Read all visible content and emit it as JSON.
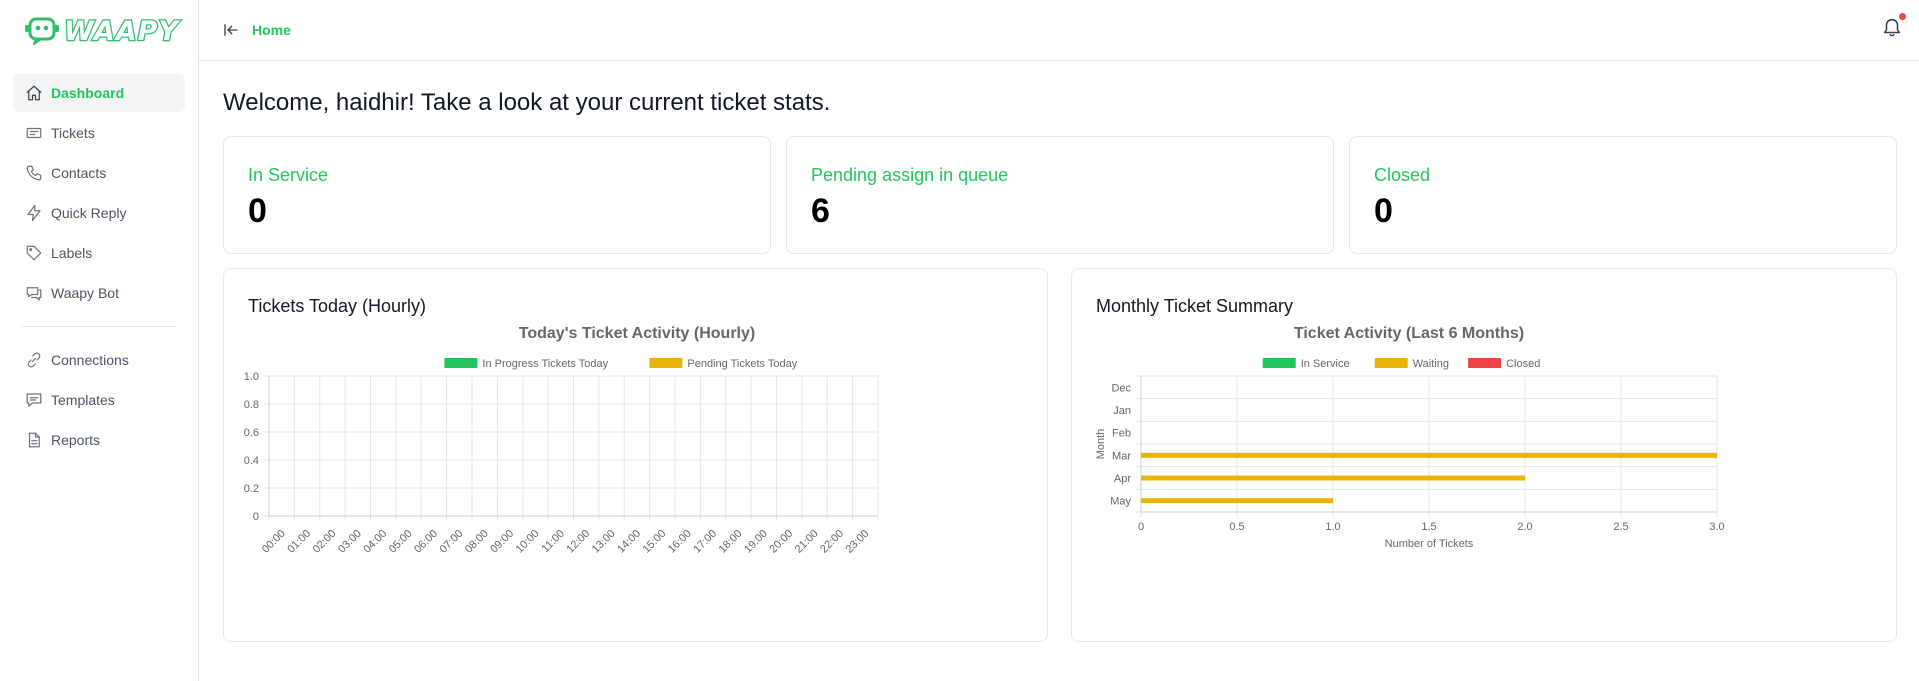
{
  "app": {
    "logo_text": "WAAPY"
  },
  "sidebar": {
    "items": [
      {
        "label": "Dashboard",
        "icon": "home-icon",
        "active": true
      },
      {
        "label": "Tickets",
        "icon": "ticket-icon"
      },
      {
        "label": "Contacts",
        "icon": "phone-icon"
      },
      {
        "label": "Quick Reply",
        "icon": "lightning-icon"
      },
      {
        "label": "Labels",
        "icon": "tag-icon"
      },
      {
        "label": "Waapy Bot",
        "icon": "chat-icon"
      }
    ],
    "items2": [
      {
        "label": "Connections",
        "icon": "link-icon"
      },
      {
        "label": "Templates",
        "icon": "message-icon"
      },
      {
        "label": "Reports",
        "icon": "file-icon"
      }
    ]
  },
  "header": {
    "breadcrumb": "Home",
    "collapse_icon": "collapse-icon",
    "bell_icon": "bell-icon"
  },
  "main": {
    "welcome": "Welcome, haidhir! Take a look at your current ticket stats.",
    "stats": [
      {
        "label": "In Service",
        "value": "0"
      },
      {
        "label": "Pending assign in queue",
        "value": "6"
      },
      {
        "label": "Closed",
        "value": "0"
      }
    ]
  },
  "colors": {
    "accent": "#22c55e",
    "waiting": "#eab308",
    "closed": "#ef4444"
  },
  "chart_data": [
    {
      "card_title": "Tickets Today (Hourly)",
      "type": "bar",
      "title": "Today's Ticket Activity (Hourly)",
      "categories": [
        "00:00",
        "01:00",
        "02:00",
        "03:00",
        "04:00",
        "05:00",
        "06:00",
        "07:00",
        "08:00",
        "09:00",
        "10:00",
        "11:00",
        "12:00",
        "13:00",
        "14:00",
        "15:00",
        "16:00",
        "17:00",
        "18:00",
        "19:00",
        "20:00",
        "21:00",
        "22:00",
        "23:00"
      ],
      "series": [
        {
          "name": "In Progress Tickets Today",
          "color": "#22c55e",
          "values": [
            0,
            0,
            0,
            0,
            0,
            0,
            0,
            0,
            0,
            0,
            0,
            0,
            0,
            0,
            0,
            0,
            0,
            0,
            0,
            0,
            0,
            0,
            0,
            0
          ]
        },
        {
          "name": "Pending Tickets Today",
          "color": "#eab308",
          "values": [
            0,
            0,
            0,
            0,
            0,
            0,
            0,
            0,
            0,
            0,
            0,
            0,
            0,
            0,
            0,
            0,
            0,
            0,
            0,
            0,
            0,
            0,
            0,
            0
          ]
        }
      ],
      "ylim": [
        0,
        1
      ],
      "yticks": [
        "0",
        "0.2",
        "0.4",
        "0.6",
        "0.8",
        "1.0"
      ],
      "legend": "top",
      "grid": true
    },
    {
      "card_title": "Monthly Ticket Summary",
      "type": "bar",
      "orientation": "horizontal",
      "title": "Ticket Activity (Last 6 Months)",
      "categories": [
        "Dec",
        "Jan",
        "Feb",
        "Mar",
        "Apr",
        "May"
      ],
      "series": [
        {
          "name": "In Service",
          "color": "#22c55e",
          "values": [
            0,
            0,
            0,
            0,
            0,
            0
          ]
        },
        {
          "name": "Waiting",
          "color": "#eab308",
          "values": [
            0,
            0,
            0,
            3,
            2,
            1
          ]
        },
        {
          "name": "Closed",
          "color": "#ef4444",
          "values": [
            0,
            0,
            0,
            0,
            0,
            0
          ]
        }
      ],
      "xlim": [
        0,
        3
      ],
      "xticks": [
        "0",
        "0.5",
        "1.0",
        "1.5",
        "2.0",
        "2.5",
        "3.0"
      ],
      "xlabel": "Number of Tickets",
      "ylabel": "Month",
      "legend": "top",
      "grid": true
    }
  ]
}
